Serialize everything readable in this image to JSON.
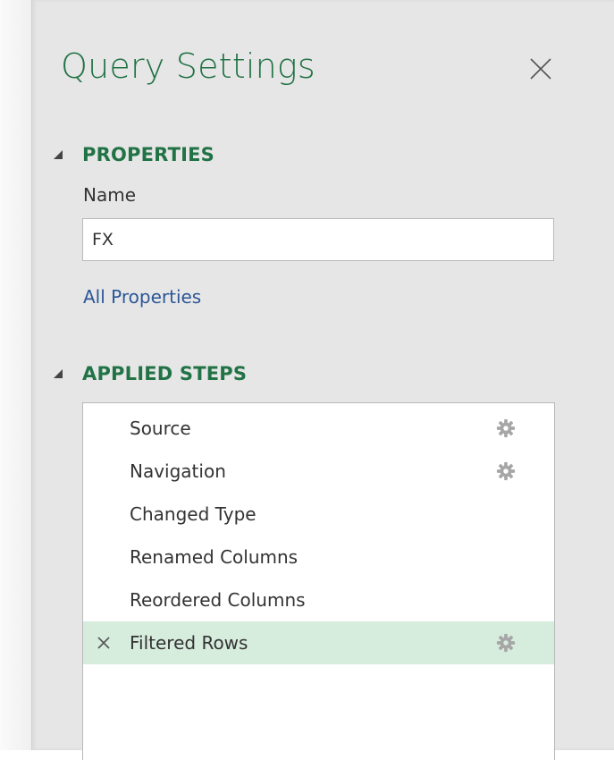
{
  "panel": {
    "title": "Query Settings",
    "close_icon": "close-icon"
  },
  "properties": {
    "header": "PROPERTIES",
    "name_label": "Name",
    "name_value": "FX",
    "all_properties_link": "All Properties"
  },
  "applied_steps": {
    "header": "APPLIED STEPS",
    "steps": [
      {
        "label": "Source",
        "has_settings": true,
        "selected": false,
        "deletable": false
      },
      {
        "label": "Navigation",
        "has_settings": true,
        "selected": false,
        "deletable": false
      },
      {
        "label": "Changed Type",
        "has_settings": false,
        "selected": false,
        "deletable": false
      },
      {
        "label": "Renamed Columns",
        "has_settings": false,
        "selected": false,
        "deletable": false
      },
      {
        "label": "Reordered Columns",
        "has_settings": false,
        "selected": false,
        "deletable": false
      },
      {
        "label": "Filtered Rows",
        "has_settings": true,
        "selected": true,
        "deletable": true
      }
    ]
  },
  "colors": {
    "accent": "#217346",
    "link": "#2b5797",
    "selected_row": "#d6ecdd",
    "panel_bg": "#e6e6e6"
  }
}
